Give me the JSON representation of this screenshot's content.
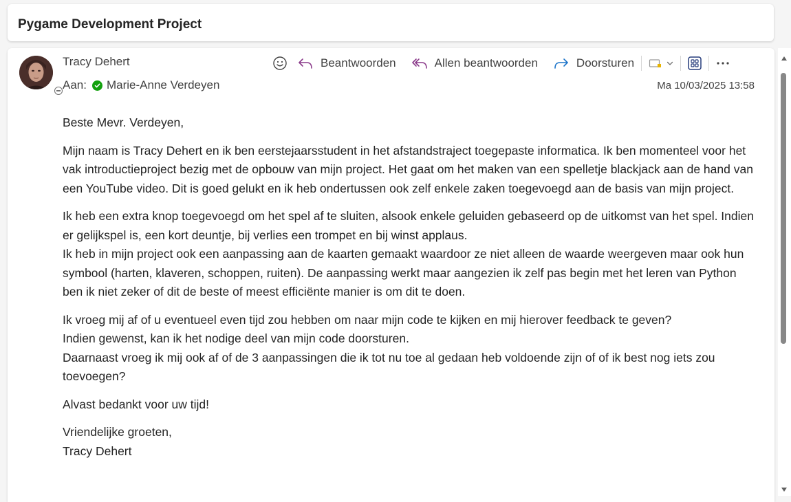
{
  "subject": "Pygame Development Project",
  "sender": {
    "name": "Tracy Dehert"
  },
  "recipients": {
    "prefix": "Aan:",
    "name": "Marie-Anne Verdeyen"
  },
  "date": "Ma 10/03/2025 13:58",
  "toolbar": {
    "reply": "Beantwoorden",
    "reply_all": "Allen beantwoorden",
    "forward": "Doorsturen"
  },
  "body": {
    "greeting": "Beste Mevr. Verdeyen,",
    "p1": "Mijn naam is Tracy Dehert en ik ben eerstejaarsstudent in het afstandstraject toegepaste informatica. Ik ben momenteel voor het vak introductieproject bezig met de opbouw van mijn project. Het gaat om het maken van een spelletje blackjack aan de hand van een YouTube video. Dit is goed gelukt en ik heb ondertussen ook zelf enkele zaken toegevoegd aan de basis van mijn project.",
    "p2_line1": "Ik heb een extra knop toegevoegd om het spel af te sluiten, alsook enkele geluiden gebaseerd op de uitkomst van het spel. Indien er gelijkspel is, een kort deuntje, bij verlies een trompet en bij winst applaus.",
    "p2_line2": "Ik heb in mijn project ook een aanpassing aan de kaarten gemaakt waardoor ze niet alleen de waarde weergeven maar ook hun symbool (harten, klaveren, schoppen, ruiten). De aanpassing werkt maar aangezien ik zelf pas begin met het leren van Python ben ik niet zeker of dit de beste of meest efficiënte manier is om dit te doen.",
    "p3_line1": "Ik vroeg mij af of u eventueel even tijd zou hebben om naar mijn code te kijken en mij hierover feedback te geven?",
    "p3_line2": "Indien gewenst, kan ik het nodige deel van mijn code doorsturen.",
    "p3_line3": "Daarnaast vroeg ik mij ook af of de 3 aanpassingen die ik tot nu toe al gedaan heb voldoende zijn of of ik best nog iets zou toevoegen?",
    "thanks": "Alvast bedankt voor uw tijd!",
    "closing": "Vriendelijke groeten,",
    "signature": "Tracy Dehert"
  },
  "colors": {
    "reply_icon": "#8a3a8a",
    "forward_icon": "#1a73c9",
    "presence_check": "#13a10e",
    "apps_icon": "#243a7a"
  },
  "icons": [
    "emoji-icon",
    "reply-icon",
    "reply-all-icon",
    "forward-icon",
    "tag-icon",
    "chevron-down-icon",
    "apps-icon",
    "more-icon"
  ]
}
